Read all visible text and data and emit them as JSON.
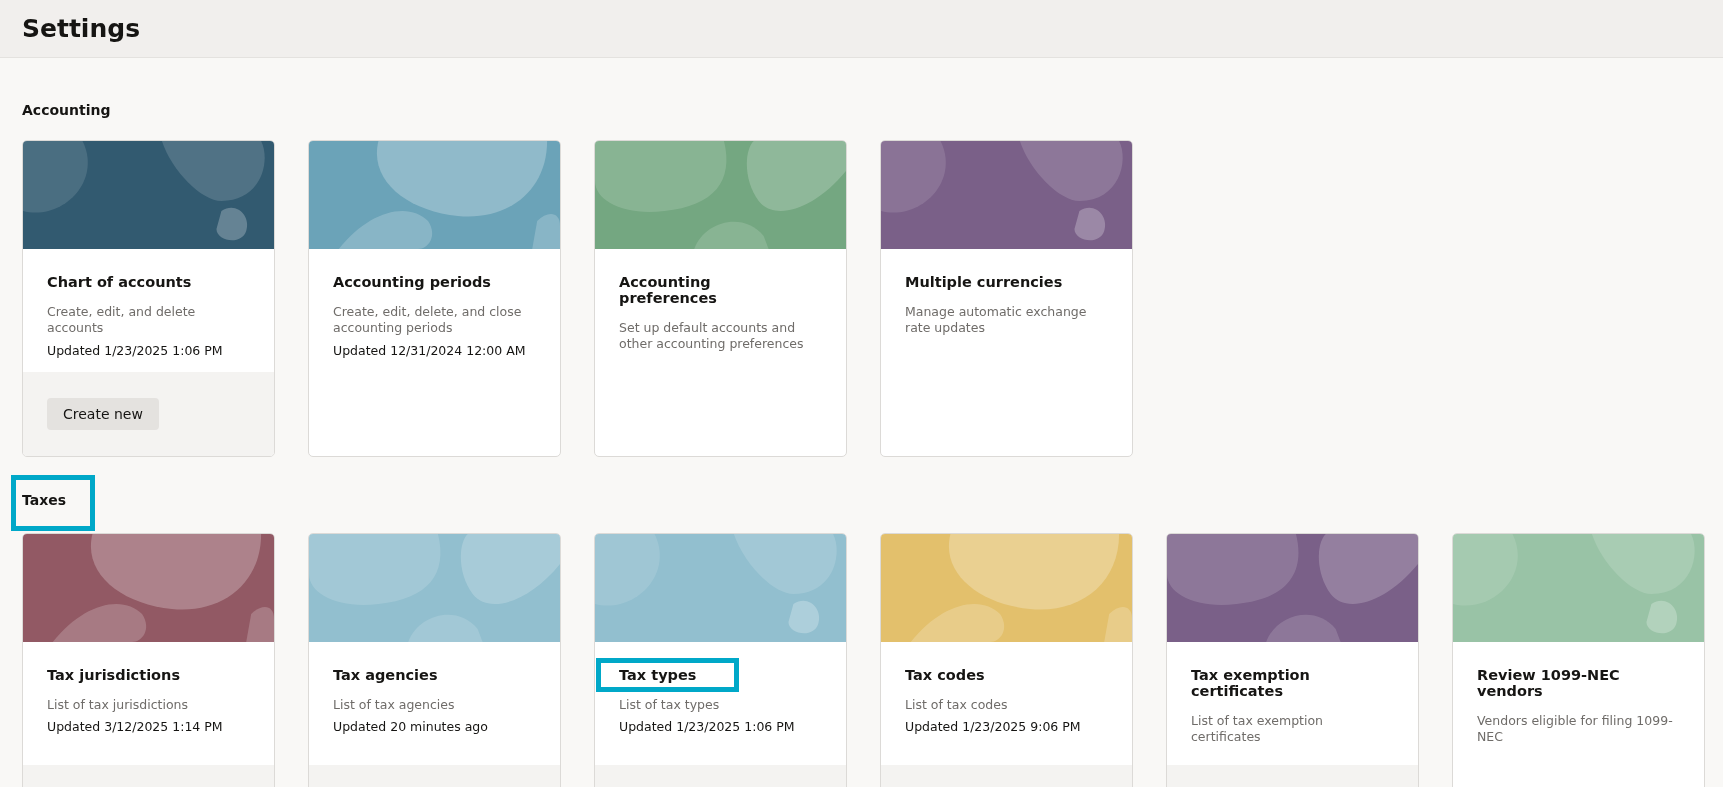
{
  "page": {
    "title": "Settings"
  },
  "sections": [
    {
      "title": "Accounting",
      "highlighted": false,
      "cards": [
        {
          "title": "Chart of accounts",
          "description": "Create, edit, and delete accounts",
          "updated": "Updated 1/23/2025 1:06 PM",
          "color": "#325a70",
          "footer": true,
          "button": "Create new",
          "highlighted": false
        },
        {
          "title": "Accounting periods",
          "description": "Create, edit, delete, and close accounting periods",
          "updated": "Updated 12/31/2024 12:00 AM",
          "color": "#6ba3b8",
          "footer": false,
          "highlighted": false
        },
        {
          "title": "Accounting preferences",
          "description": "Set up default accounts and other accounting preferences",
          "color": "#74a781",
          "footer": false,
          "highlighted": false
        },
        {
          "title": "Multiple currencies",
          "description": "Manage automatic exchange rate updates",
          "color": "#7a6088",
          "footer": false,
          "highlighted": false
        }
      ]
    },
    {
      "title": "Taxes",
      "highlighted": true,
      "cards": [
        {
          "title": "Tax jurisdictions",
          "description": "List of tax jurisdictions",
          "updated": "Updated 3/12/2025 1:14 PM",
          "color": "#925964",
          "footer": true,
          "highlighted": false
        },
        {
          "title": "Tax agencies",
          "description": "List of tax agencies",
          "updated": "Updated 20 minutes ago",
          "color": "#92bfcf",
          "footer": true,
          "highlighted": false
        },
        {
          "title": "Tax types",
          "description": "List of tax types",
          "updated": "Updated 1/23/2025 1:06 PM",
          "color": "#92bfcf",
          "footer": true,
          "highlighted": true
        },
        {
          "title": "Tax codes",
          "description": "List of tax codes",
          "updated": "Updated 1/23/2025 9:06 PM",
          "color": "#e3c06c",
          "footer": true,
          "highlighted": false
        },
        {
          "title": "Tax exemption certificates",
          "description": "List of tax exemption certificates",
          "color": "#7a6088",
          "footer": true,
          "highlighted": false
        },
        {
          "title": "Review 1099-NEC vendors",
          "description": "Vendors eligible for filing 1099-NEC",
          "color": "#99c3a6",
          "footer": false,
          "highlighted": false
        }
      ]
    }
  ]
}
